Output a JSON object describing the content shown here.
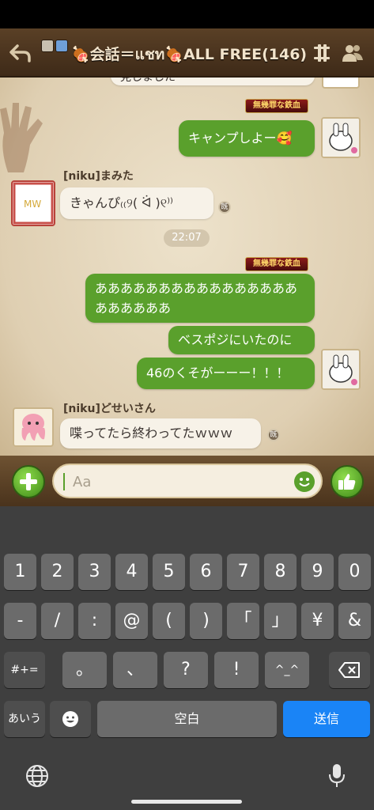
{
  "header": {
    "title": "🍖会話＝แชท🍖ALL FREE(146)"
  },
  "chat": {
    "partial_top": "見しました",
    "badge_text": "無幾罪な鉄血",
    "messages_out_1": "キャンプしよー🥰",
    "sender_1": "[niku]まみた",
    "message_in_1": "きゃんぴ₍₍୨( ᐛ )୧⁾⁾",
    "time_separator": "22:07",
    "out_2a_line1": "ああああああああああああああああ",
    "out_2a_line2": "ああああああ",
    "out_2b": "ベスポジにいたのに",
    "out_2c": "46のくそがーーー！！！",
    "sender_2": "[niku]どせいさん",
    "message_in_2": "喋ってたら終わってたｗｗｗ",
    "read_mark": "既"
  },
  "input": {
    "placeholder": "Aa"
  },
  "keyboard": {
    "row1": [
      "1",
      "2",
      "3",
      "4",
      "5",
      "6",
      "7",
      "8",
      "9",
      "0"
    ],
    "row2": [
      "-",
      "/",
      ":",
      "@",
      "(",
      ")",
      "「",
      "」",
      "¥",
      "&"
    ],
    "row3_left": "#+=",
    "row3": [
      "。",
      "、",
      "?",
      "!",
      "^_^"
    ],
    "row4_left": "あいう",
    "space_label": "空白",
    "send_label": "送信"
  },
  "colors": {
    "bubble_out": "#5aa02c",
    "bubble_in": "#f7f2e8",
    "send_key": "#1a84f6",
    "header_bg": "#4a331c"
  },
  "icons": [
    "back-arrow-icon",
    "settings-icon",
    "members-icon",
    "plus-icon",
    "emoji-icon",
    "thumbs-up-icon",
    "globe-icon",
    "microphone-icon",
    "delete-icon",
    "emoji-keyboard-icon"
  ]
}
